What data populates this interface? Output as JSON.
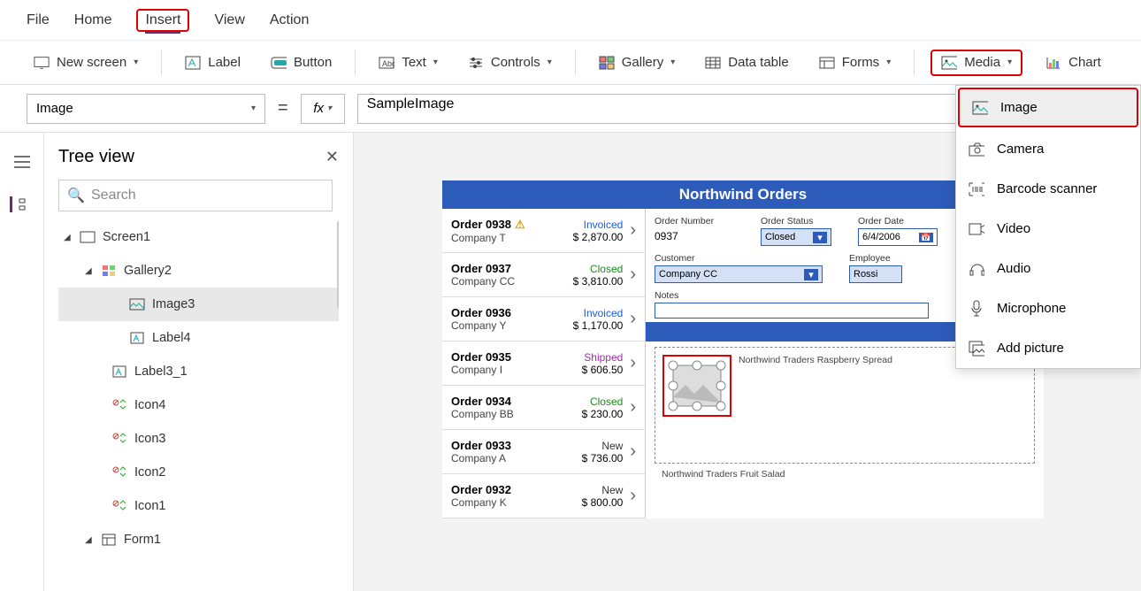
{
  "top_menu": {
    "file": "File",
    "home": "Home",
    "insert": "Insert",
    "view": "View",
    "action": "Action"
  },
  "ribbon": {
    "new_screen": "New screen",
    "label": "Label",
    "button": "Button",
    "text": "Text",
    "controls": "Controls",
    "gallery": "Gallery",
    "data_table": "Data table",
    "forms": "Forms",
    "media": "Media",
    "chart": "Chart"
  },
  "formula": {
    "property": "Image",
    "value": "SampleImage",
    "fx": "fx"
  },
  "tree": {
    "title": "Tree view",
    "search_placeholder": "Search",
    "nodes": [
      "Screen1",
      "Gallery2",
      "Image3",
      "Label4",
      "Label3_1",
      "Icon4",
      "Icon3",
      "Icon2",
      "Icon1",
      "Form1"
    ]
  },
  "media_menu": [
    "Image",
    "Camera",
    "Barcode scanner",
    "Video",
    "Audio",
    "Microphone",
    "Add picture"
  ],
  "app": {
    "title": "Northwind Orders",
    "orders": [
      {
        "id": "Order 0938",
        "company": "Company T",
        "status": "Invoiced",
        "price": "$ 2,870.00",
        "warn": true
      },
      {
        "id": "Order 0937",
        "company": "Company CC",
        "status": "Closed",
        "price": "$ 3,810.00"
      },
      {
        "id": "Order 0936",
        "company": "Company Y",
        "status": "Invoiced",
        "price": "$ 1,170.00"
      },
      {
        "id": "Order 0935",
        "company": "Company I",
        "status": "Shipped",
        "price": "$ 606.50"
      },
      {
        "id": "Order 0934",
        "company": "Company BB",
        "status": "Closed",
        "price": "$ 230.00"
      },
      {
        "id": "Order 0933",
        "company": "Company A",
        "status": "New",
        "price": "$ 736.00"
      },
      {
        "id": "Order 0932",
        "company": "Company K",
        "status": "New",
        "price": "$ 800.00"
      }
    ],
    "detail": {
      "labels": {
        "order_number": "Order Number",
        "order_status": "Order Status",
        "order_date": "Order Date",
        "customer": "Customer",
        "employee": "Employee",
        "notes": "Notes"
      },
      "order_number": "0937",
      "order_status": "Closed",
      "order_date": "6/4/2006",
      "customer": "Company CC",
      "employee": "Rossi",
      "product1": "Northwind Traders Raspberry Spread",
      "product2": "Northwind Traders Fruit Salad"
    }
  }
}
